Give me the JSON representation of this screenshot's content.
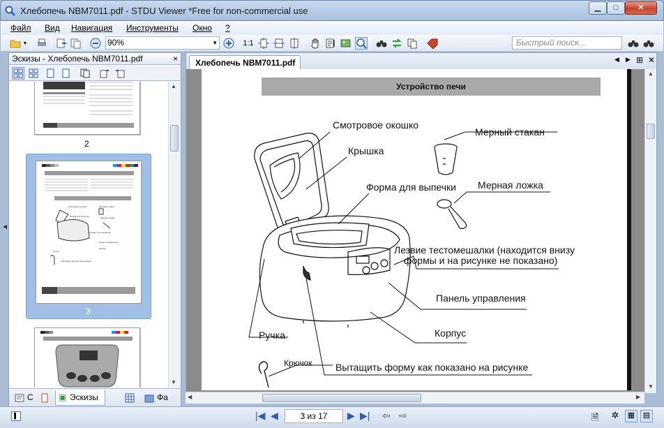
{
  "window": {
    "title": "Хлебопечь NBM7011.pdf - STDU Viewer *Free for non-commercial use",
    "controls": [
      "minimize",
      "maximize",
      "close"
    ]
  },
  "menu": [
    {
      "label": "Файл"
    },
    {
      "label": "Вид"
    },
    {
      "label": "Навигация"
    },
    {
      "label": "Инструменты"
    },
    {
      "label": "Окно"
    },
    {
      "label": "?"
    }
  ],
  "toolbar": {
    "zoom_value": "90%",
    "fit_label": "1:1",
    "search_placeholder": "Быстрый поиск..."
  },
  "left_panel": {
    "header": "Эскизы - Хлебопечь NBM7011.pdf",
    "close_symbol": "×",
    "thumbnails": [
      {
        "page_label": "2",
        "selected": false
      },
      {
        "page_label": "3",
        "selected": true
      },
      {
        "page_label": "",
        "selected": false
      }
    ],
    "tabs": [
      {
        "label": "С"
      },
      {
        "label": "Эскизы",
        "active": true
      },
      {
        "label": "Фа"
      }
    ]
  },
  "document": {
    "tab_title": "Хлебопечь NBM7011.pdf",
    "page_header": "Устройство печи",
    "labels": {
      "window": "Смотровое окошко",
      "lid": "Крышка",
      "measuring_cup": "Мерный стакан",
      "baking_form": "Форма для выпечки",
      "measuring_spoon": "Мерная ложка",
      "blade_line1": "Лезвие тестомешалки (находится внизу",
      "blade_line2": "формы и на рисунке не показано)",
      "control_panel": "Панель управления",
      "handle": "Ручка",
      "body": "Корпус",
      "hook": "Крючок",
      "pull_form": "Вытащить форму как показано на рисунке"
    }
  },
  "status_bar": {
    "page_indicator": "3 из 17"
  },
  "colors": {
    "accent": "#2a5dae",
    "selection": "#9fbfe6",
    "page_header_bg": "#a9a9a9",
    "close_button": "#c4442d"
  }
}
